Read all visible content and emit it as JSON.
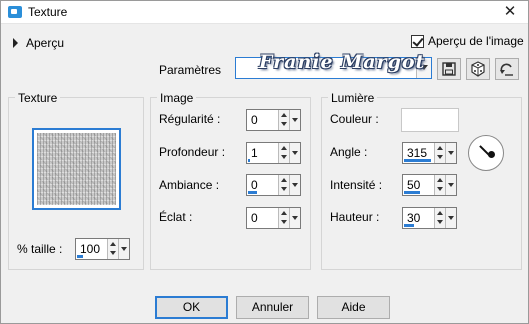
{
  "window": {
    "title": "Texture",
    "close_glyph": "✕"
  },
  "preview": {
    "label": "Aperçu",
    "show_preview_label": "Aperçu de l'image",
    "show_preview_checked": true
  },
  "presets": {
    "label": "Paramètres",
    "current_value": "",
    "watermark": "Franie Margot"
  },
  "toolbar_icons": [
    "save-icon",
    "random-dice-icon",
    "reset-icon"
  ],
  "texture_group": {
    "title": "Texture",
    "size_label": "% taille :",
    "size_value": "100",
    "size_bar_percent": 20
  },
  "image_group": {
    "title": "Image",
    "fields": [
      {
        "label": "Régularité :",
        "value": "0",
        "bar_percent": 0
      },
      {
        "label": "Profondeur :",
        "value": "1",
        "bar_percent": 5
      },
      {
        "label": "Ambiance :",
        "value": "0",
        "bar_percent": 30
      },
      {
        "label": "Éclat :",
        "value": "0",
        "bar_percent": 0
      }
    ]
  },
  "light_group": {
    "title": "Lumière",
    "color_label": "Couleur :",
    "color_value": "#ffffff",
    "fields": [
      {
        "label": "Angle :",
        "value": "315",
        "bar_percent": 88
      },
      {
        "label": "Intensité :",
        "value": "50",
        "bar_percent": 50
      },
      {
        "label": "Hauteur :",
        "value": "30",
        "bar_percent": 33
      }
    ],
    "angle_degrees": 315
  },
  "buttons": {
    "ok": "OK",
    "cancel": "Annuler",
    "help": "Aide"
  },
  "colors": {
    "accent": "#2b7cd3",
    "dialog_bg": "#f0f0f0"
  }
}
